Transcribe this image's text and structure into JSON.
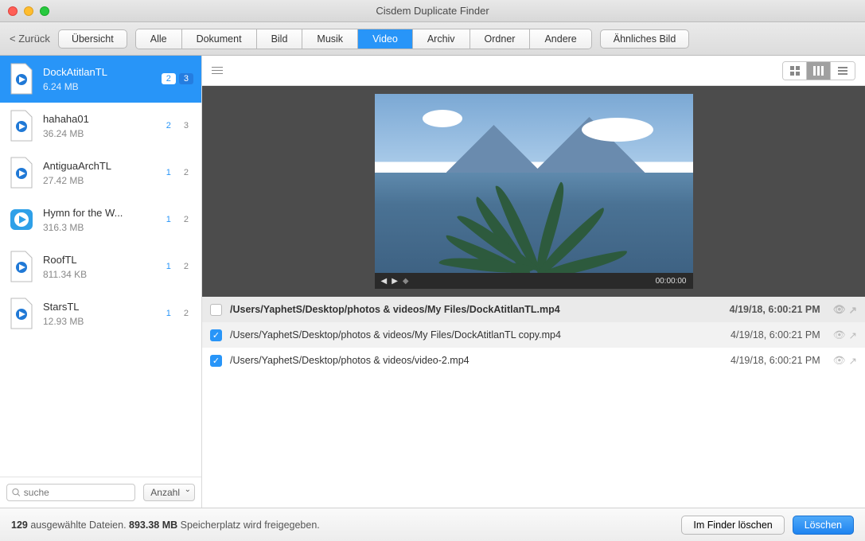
{
  "window": {
    "title": "Cisdem Duplicate Finder"
  },
  "toolbar": {
    "back": "< Zurück",
    "overview": "Übersicht",
    "tabs": [
      "Alle",
      "Dokument",
      "Bild",
      "Musik",
      "Video",
      "Archiv",
      "Ordner",
      "Andere"
    ],
    "active_tab": "Video",
    "similar": "Ähnliches Bild"
  },
  "sidebar": {
    "items": [
      {
        "name": "DockAtitlanTL",
        "size": "6.24 MB",
        "selected_count": "2",
        "total_count": "3",
        "active": true,
        "icon": "qt"
      },
      {
        "name": "hahaha01",
        "size": "36.24 MB",
        "selected_count": "2",
        "total_count": "3",
        "active": false,
        "icon": "qt"
      },
      {
        "name": "AntiguaArchTL",
        "size": "27.42 MB",
        "selected_count": "1",
        "total_count": "2",
        "active": false,
        "icon": "qt"
      },
      {
        "name": "Hymn for the W...",
        "size": "316.3 MB",
        "selected_count": "1",
        "total_count": "2",
        "active": false,
        "icon": "play"
      },
      {
        "name": "RoofTL",
        "size": "811.34 KB",
        "selected_count": "1",
        "total_count": "2",
        "active": false,
        "icon": "qt"
      },
      {
        "name": "StarsTL",
        "size": "12.93 MB",
        "selected_count": "1",
        "total_count": "2",
        "active": false,
        "icon": "qt"
      }
    ],
    "search_placeholder": "suche",
    "sort_label": "Anzahl"
  },
  "preview": {
    "time": "00:00:00"
  },
  "files": [
    {
      "checked": false,
      "path": "/Users/YaphetS/Desktop/photos & videos/My Files/DockAtitlanTL.mp4",
      "date": "4/19/18, 6:00:21 PM",
      "header": true
    },
    {
      "checked": true,
      "path": "/Users/YaphetS/Desktop/photos & videos/My Files/DockAtitlanTL copy.mp4",
      "date": "4/19/18, 6:00:21 PM",
      "header": false
    },
    {
      "checked": true,
      "path": "/Users/YaphetS/Desktop/photos & videos/video-2.mp4",
      "date": "4/19/18, 6:00:21 PM",
      "header": false
    }
  ],
  "footer": {
    "selected_count": "129",
    "selected_label": " ausgewählte Dateien. ",
    "size": "893.38 MB",
    "size_label": " Speicherplatz wird freigegeben.",
    "finder_btn": "Im Finder löschen",
    "delete_btn": "Löschen"
  }
}
